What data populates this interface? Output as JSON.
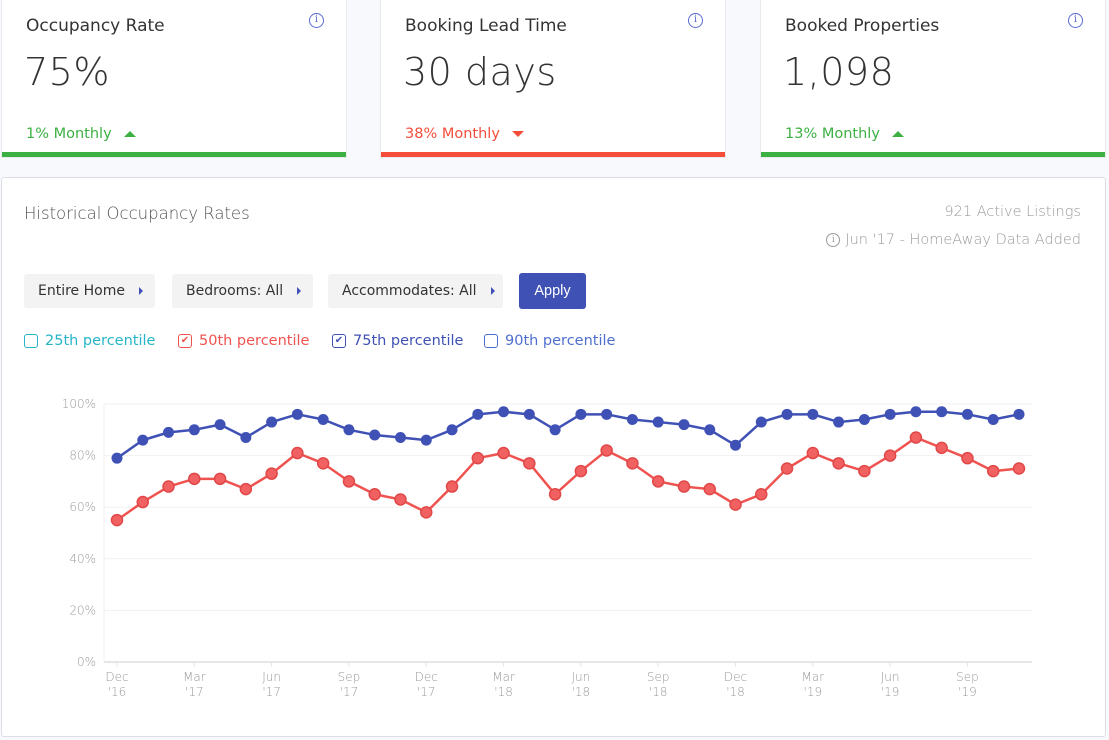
{
  "kpis": [
    {
      "title": "Occupancy Rate",
      "value": "75%",
      "change": "1% Monthly",
      "direction": "up",
      "color": "#3cb043"
    },
    {
      "title": "Booking Lead Time",
      "value": "30 days",
      "change": "38% Monthly",
      "direction": "down",
      "color": "#f44e3b"
    },
    {
      "title": "Booked Properties",
      "value": "1,098",
      "change": "13% Monthly",
      "direction": "up",
      "color": "#3cb043"
    }
  ],
  "panel": {
    "title": "Historical Occupancy Rates",
    "active_listings": "921 Active Listings",
    "note": "Jun '17 - HomeAway Data Added",
    "info_glyph": "i"
  },
  "filters": [
    {
      "label": "Entire Home"
    },
    {
      "label": "Bedrooms: All"
    },
    {
      "label": "Accommodates: All"
    }
  ],
  "apply_label": "Apply",
  "legend": [
    {
      "label": "25th percentile",
      "checked": false,
      "color": "#26b5c8"
    },
    {
      "label": "50th percentile",
      "checked": true,
      "color": "#ef5350"
    },
    {
      "label": "75th percentile",
      "checked": true,
      "color": "#3f51b5"
    },
    {
      "label": "90th percentile",
      "checked": false,
      "color": "#4f6fd0"
    }
  ],
  "chart_data": {
    "type": "line",
    "title": "Historical Occupancy Rates",
    "xlabel": "",
    "ylabel": "",
    "ylim": [
      0,
      100
    ],
    "y_ticks": [
      "0%",
      "20%",
      "40%",
      "60%",
      "80%",
      "100%"
    ],
    "x_tick_labels": [
      {
        "index": 0,
        "line1": "Dec",
        "line2": "'16"
      },
      {
        "index": 3,
        "line1": "Mar",
        "line2": "'17"
      },
      {
        "index": 6,
        "line1": "Jun",
        "line2": "'17"
      },
      {
        "index": 9,
        "line1": "Sep",
        "line2": "'17"
      },
      {
        "index": 12,
        "line1": "Dec",
        "line2": "'17"
      },
      {
        "index": 15,
        "line1": "Mar",
        "line2": "'18"
      },
      {
        "index": 18,
        "line1": "Jun",
        "line2": "'18"
      },
      {
        "index": 21,
        "line1": "Sep",
        "line2": "'18"
      },
      {
        "index": 24,
        "line1": "Dec",
        "line2": "'18"
      },
      {
        "index": 27,
        "line1": "Mar",
        "line2": "'19"
      },
      {
        "index": 30,
        "line1": "Jun",
        "line2": "'19"
      },
      {
        "index": 33,
        "line1": "Sep",
        "line2": "'19"
      }
    ],
    "x": [
      "Dec '16",
      "Jan '17",
      "Feb '17",
      "Mar '17",
      "Apr '17",
      "May '17",
      "Jun '17",
      "Jul '17",
      "Aug '17",
      "Sep '17",
      "Oct '17",
      "Nov '17",
      "Dec '17",
      "Jan '18",
      "Feb '18",
      "Mar '18",
      "Apr '18",
      "May '18",
      "Jun '18",
      "Jul '18",
      "Aug '18",
      "Sep '18",
      "Oct '18",
      "Nov '18",
      "Dec '18",
      "Jan '19",
      "Feb '19",
      "Mar '19",
      "Apr '19",
      "May '19",
      "Jun '19",
      "Jul '19",
      "Aug '19",
      "Sep '19",
      "Oct '19",
      "Nov '19"
    ],
    "series": [
      {
        "name": "75th percentile",
        "color": "#3f51b5",
        "values": [
          79,
          86,
          89,
          90,
          92,
          87,
          93,
          96,
          94,
          90,
          88,
          87,
          86,
          90,
          96,
          97,
          96,
          90,
          96,
          96,
          94,
          93,
          92,
          90,
          84,
          93,
          96,
          96,
          93,
          94,
          96,
          97,
          97,
          96,
          94,
          96
        ]
      },
      {
        "name": "50th percentile",
        "color": "#ef5350",
        "values": [
          55,
          62,
          68,
          71,
          71,
          67,
          73,
          81,
          77,
          70,
          65,
          63,
          58,
          68,
          79,
          81,
          77,
          65,
          74,
          82,
          77,
          70,
          68,
          67,
          61,
          65,
          75,
          81,
          77,
          74,
          80,
          87,
          83,
          79,
          74,
          75
        ]
      }
    ],
    "grid": true,
    "legend_position": "top-left"
  }
}
